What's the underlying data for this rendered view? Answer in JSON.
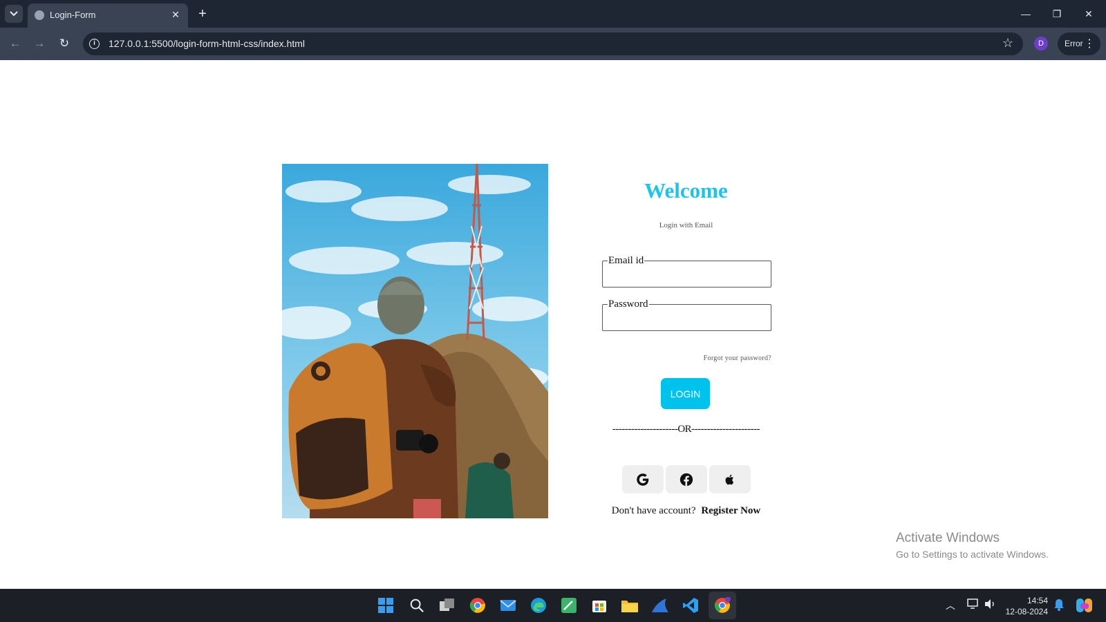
{
  "browser": {
    "tab_title": "Login-Form",
    "url": "127.0.0.1:5500/login-form-html-css/index.html",
    "profile_initial": "D",
    "error_label": "Error"
  },
  "login": {
    "title": "Welcome",
    "subtitle": "Login with Email",
    "email_legend": "Email id",
    "password_legend": "Password",
    "forgot": "Forgot your password?",
    "login_button": "LOGIN",
    "or_divider": "---------------------OR----------------------",
    "register_prompt": "Don't have account?",
    "register_link": "Register Now",
    "accent_color": "#1ec3ea",
    "button_color": "#00c2ed"
  },
  "social_buttons": [
    "google-icon",
    "facebook-icon",
    "apple-icon"
  ],
  "watermark": {
    "line1": "Activate Windows",
    "line2": "Go to Settings to activate Windows."
  },
  "taskbar": {
    "time": "14:54",
    "date": "12-08-2024",
    "apps": [
      "start-icon",
      "search-icon",
      "task-view-icon",
      "chrome-icon",
      "mail-icon",
      "edge-icon",
      "photos-icon",
      "store-icon",
      "file-explorer-icon",
      "shark-app-icon",
      "vscode-icon",
      "chrome-profile-icon"
    ]
  }
}
